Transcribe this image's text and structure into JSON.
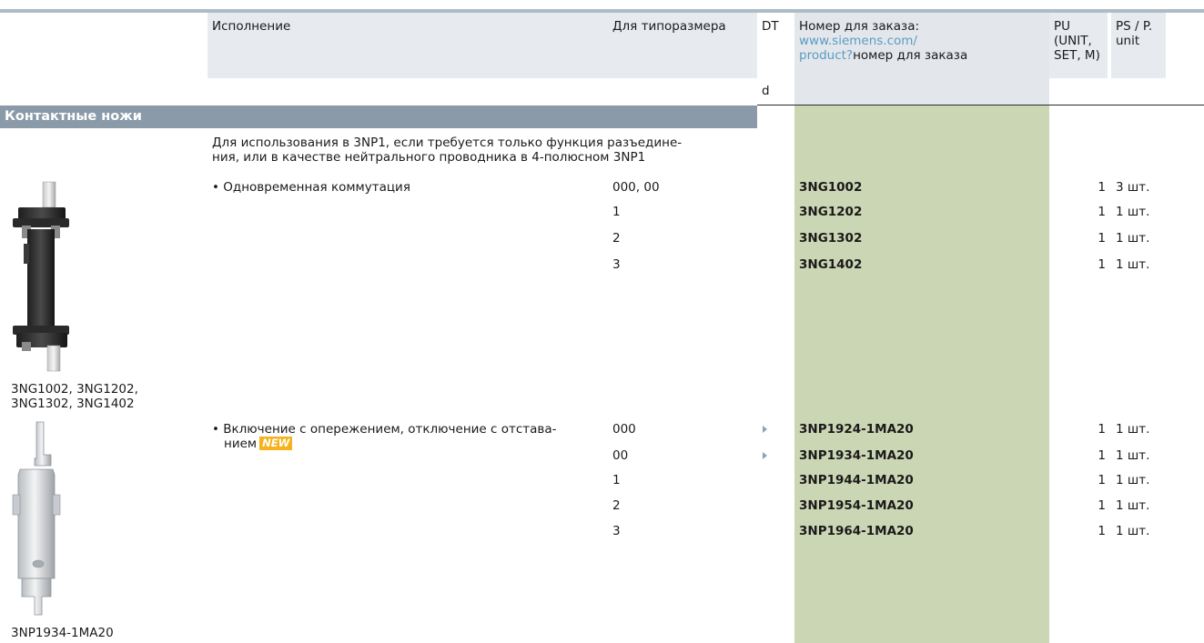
{
  "header": {
    "col_variant": "Исполнение",
    "col_size": "Для типоразмера",
    "col_dt": "DT",
    "col_dt_sub": "d",
    "col_order_line1": "Номер для заказа:",
    "col_order_link1": "www.siemens.com/",
    "col_order_link2": "product?",
    "col_order_tail": "номер для заказа",
    "col_pu_line1": "PU",
    "col_pu_line2": "(UNIT,",
    "col_pu_line3": "SET, M)",
    "col_ps_line1": "PS / P.",
    "col_ps_line2": "unit"
  },
  "section": {
    "title": "Контактные ножи",
    "description_line1": "Для использования в 3NP1, если требуется только функция разъедине-",
    "description_line2": "ния, или в качестве нейтрального проводника в 4-полюсном 3NP1"
  },
  "group1": {
    "variant": "• Одновременная коммутация",
    "image_caption_line1": "3NG1002, 3NG1202,",
    "image_caption_line2": "3NG1302, 3NG1402",
    "rows": [
      {
        "size": "000, 00",
        "order": "3NG1002",
        "pu": "1",
        "ps": "3 шт."
      },
      {
        "size": "1",
        "order": "3NG1202",
        "pu": "1",
        "ps": "1 шт."
      },
      {
        "size": "2",
        "order": "3NG1302",
        "pu": "1",
        "ps": "1 шт."
      },
      {
        "size": "3",
        "order": "3NG1402",
        "pu": "1",
        "ps": "1 шт."
      }
    ]
  },
  "group2": {
    "variant_line1": "• Включение с опережением, отключение с отстава-",
    "variant_line2": "нием",
    "new_badge": "NEW",
    "image_caption": "3NP1934-1MA20",
    "rows": [
      {
        "size": "000",
        "order": "3NP1924-1MA20",
        "pu": "1",
        "ps": "1 шт.",
        "dt_marker": true
      },
      {
        "size": "00",
        "order": "3NP1934-1MA20",
        "pu": "1",
        "ps": "1 шт.",
        "dt_marker": true
      },
      {
        "size": "1",
        "order": "3NP1944-1MA20",
        "pu": "1",
        "ps": "1 шт.",
        "dt_marker": false
      },
      {
        "size": "2",
        "order": "3NP1954-1MA20",
        "pu": "1",
        "ps": "1 шт.",
        "dt_marker": false
      },
      {
        "size": "3",
        "order": "3NP1964-1MA20",
        "pu": "1",
        "ps": "1 шт.",
        "dt_marker": false
      }
    ]
  },
  "colors": {
    "header_shade": "#e7ebef",
    "section_bar": "#8a9aa8",
    "order_column": "#cbd6b4",
    "link": "#5b9bc4",
    "new_badge": "#f5b21c"
  }
}
